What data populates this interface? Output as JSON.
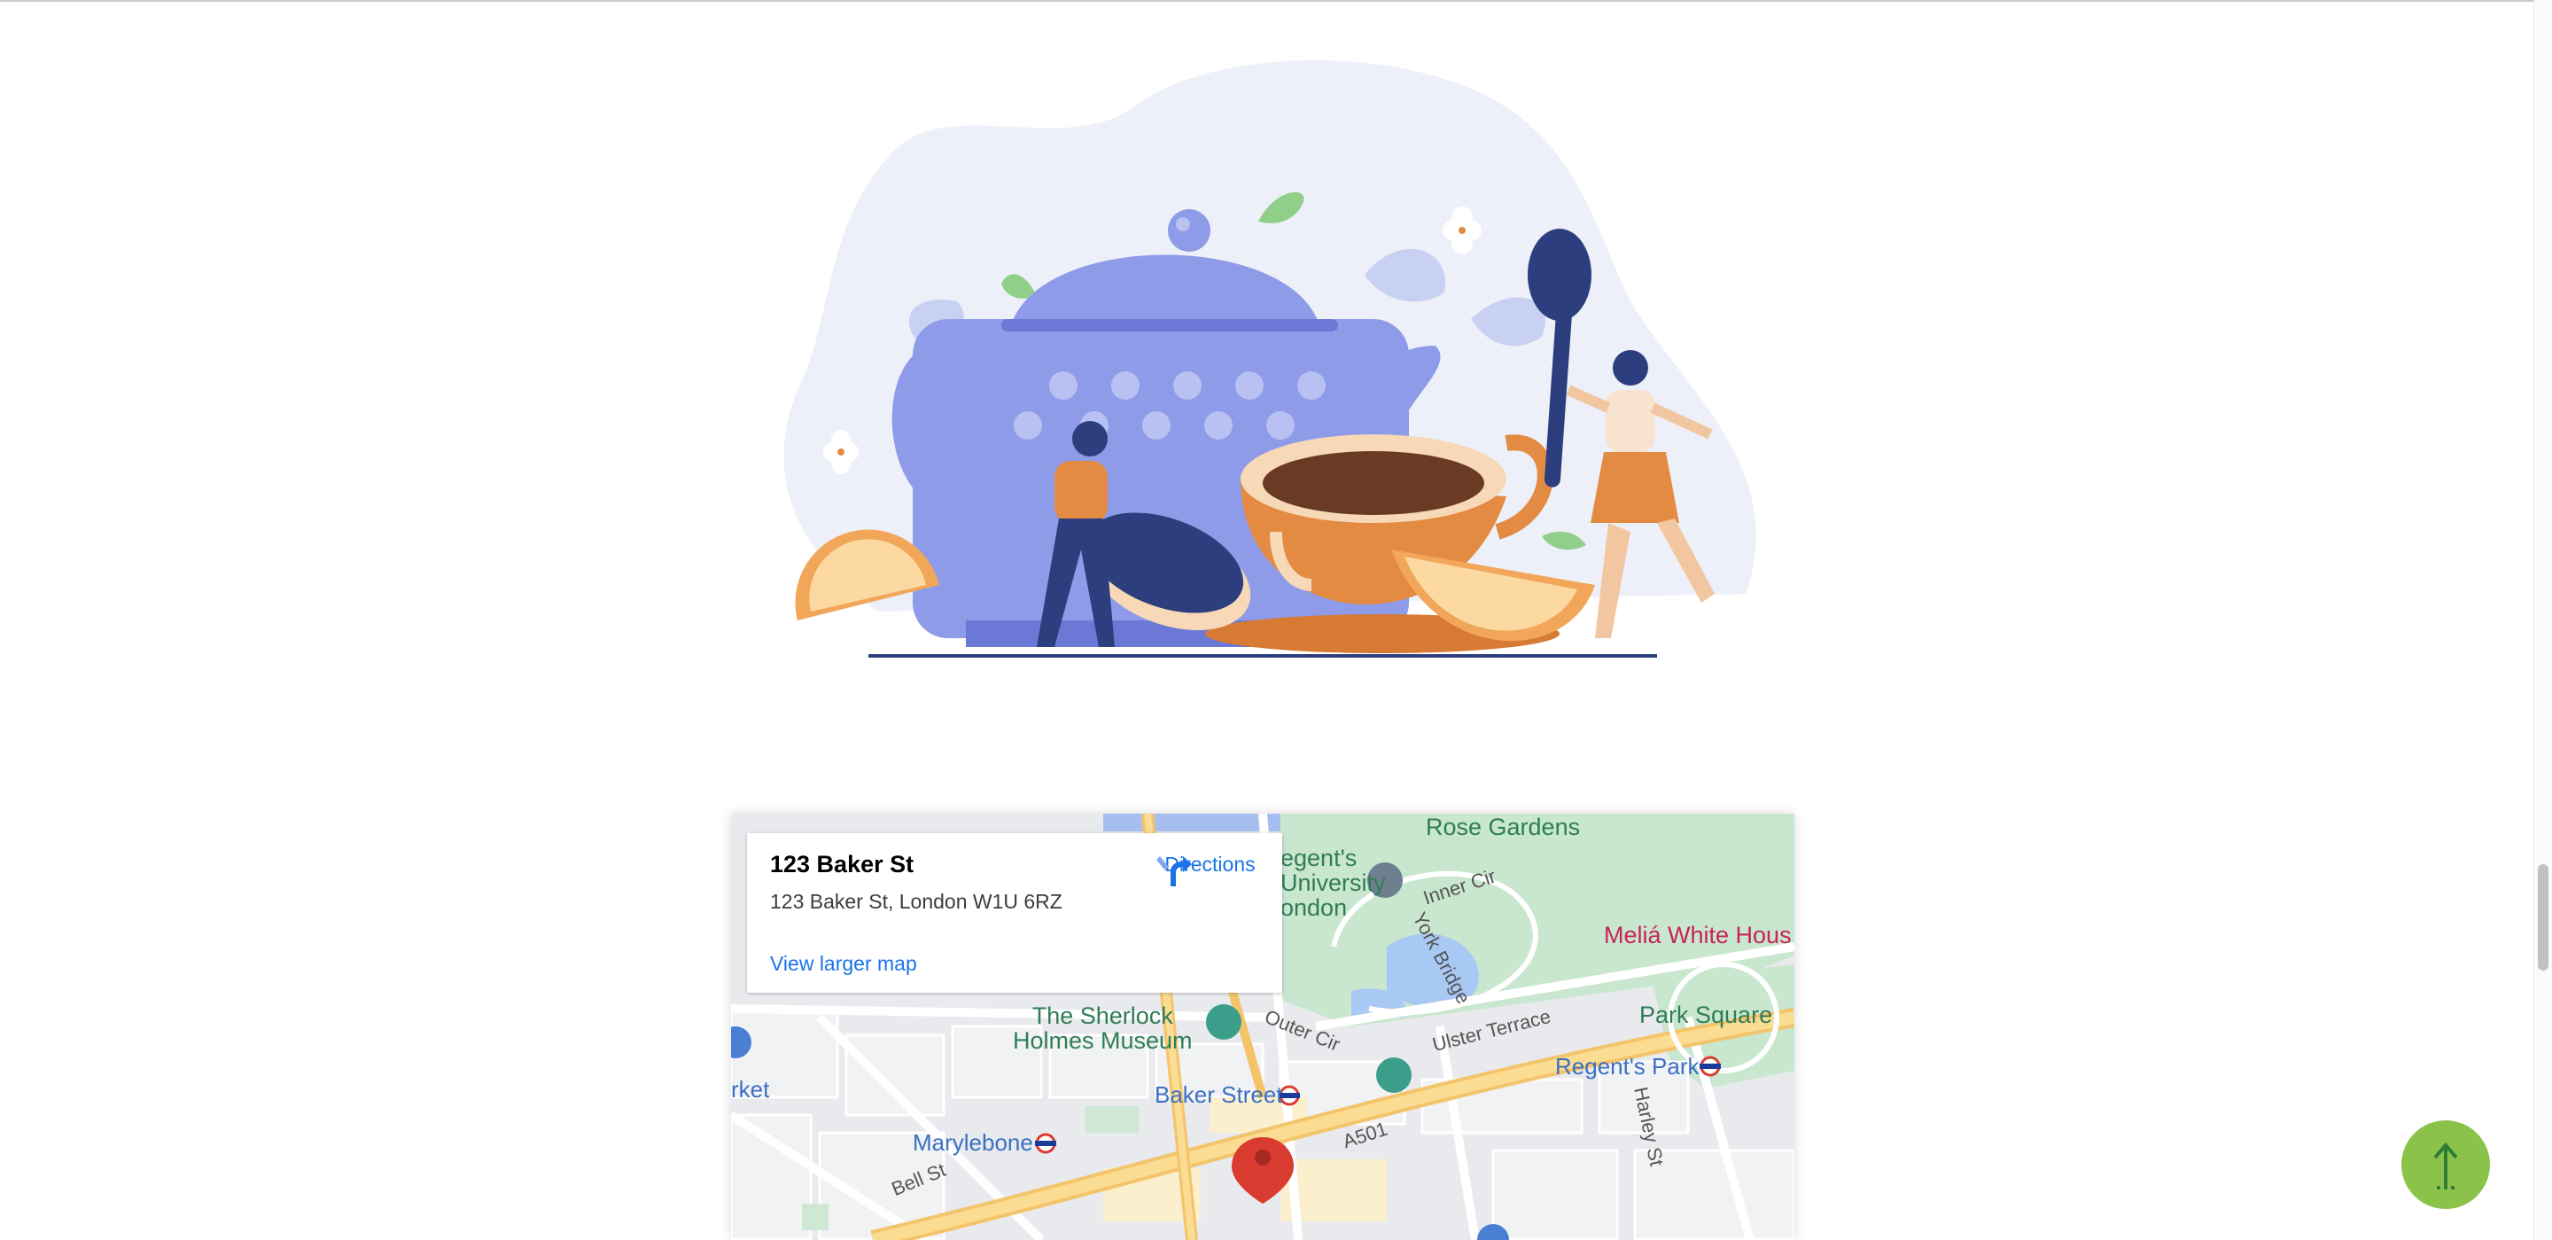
{
  "map": {
    "info": {
      "title": "123 Baker St",
      "address": "123 Baker St, London W1U 6RZ",
      "directions_label": "Directions",
      "larger_map_label": "View larger map"
    },
    "labels": {
      "rose_gardens": "Rose Gardens",
      "regents_university": "egent's\nUniversity\nondon",
      "inner_circle": "Inner Cir",
      "york_bridge": "York Bridge",
      "melia": "Meliá White Hous",
      "sherlock": "The Sherlock\nHolmes Museum",
      "outer_circle": "Outer Cir",
      "ulster_terrace": "Ulster Terrace",
      "park_square": "Park Square",
      "regents_park_station": "Regent's Park",
      "baker_street_station": "Baker Street",
      "marylebone_station": "Marylebone",
      "a501": "A501",
      "harley_st": "Harley St",
      "bell_st": "Bell St",
      "market_fragment": "rket"
    }
  },
  "colors": {
    "accent_green": "#8bc34a",
    "link_blue": "#1a73e8",
    "teapot": "#8e9be8",
    "cup": "#e38b43"
  },
  "icons": {
    "directions": "directions-icon",
    "scroll_top": "arrow-up-icon",
    "map_pin": "map-pin-icon"
  }
}
